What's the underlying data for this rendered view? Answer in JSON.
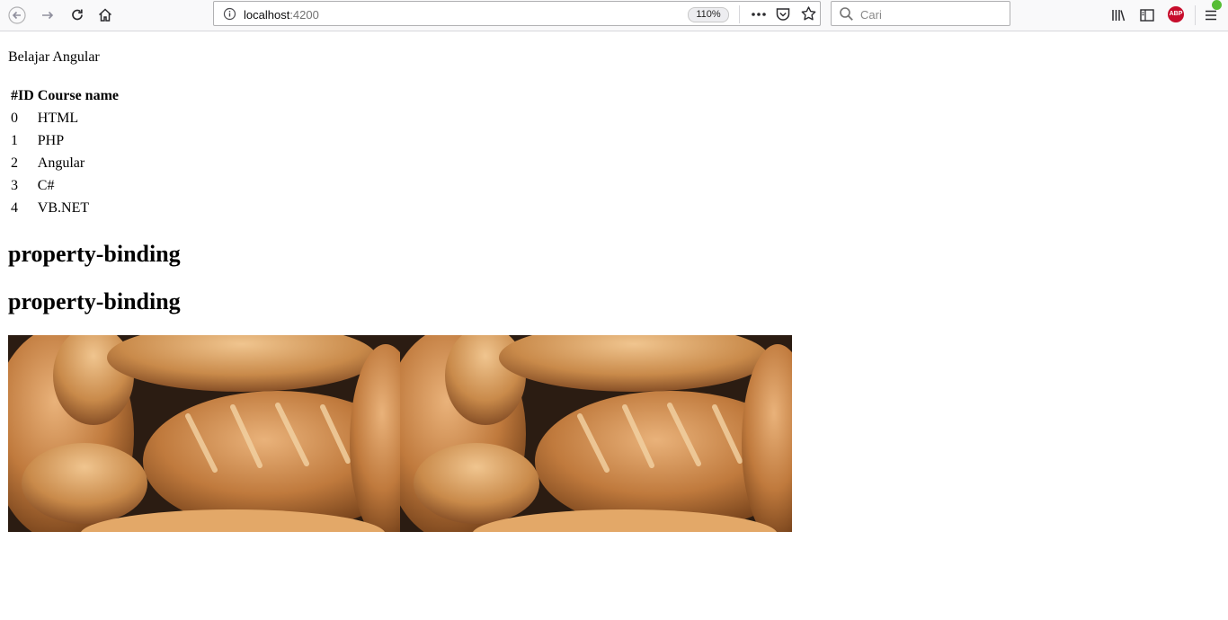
{
  "browser": {
    "url_host": "localhost",
    "url_port": ":4200",
    "zoom": "110%",
    "search_placeholder": "Cari",
    "adblock_label": "ABP"
  },
  "page": {
    "intro_text": "Belajar Angular",
    "table": {
      "headers": [
        "#ID",
        "Course name"
      ],
      "rows": [
        [
          "0",
          "HTML"
        ],
        [
          "1",
          "PHP"
        ],
        [
          "2",
          "Angular"
        ],
        [
          "3",
          "C#"
        ],
        [
          "4",
          "VB.NET"
        ]
      ]
    },
    "headings": [
      "property-binding",
      "property-binding"
    ],
    "images": [
      {
        "alt": "bread loaves"
      },
      {
        "alt": "bread loaves"
      }
    ]
  }
}
